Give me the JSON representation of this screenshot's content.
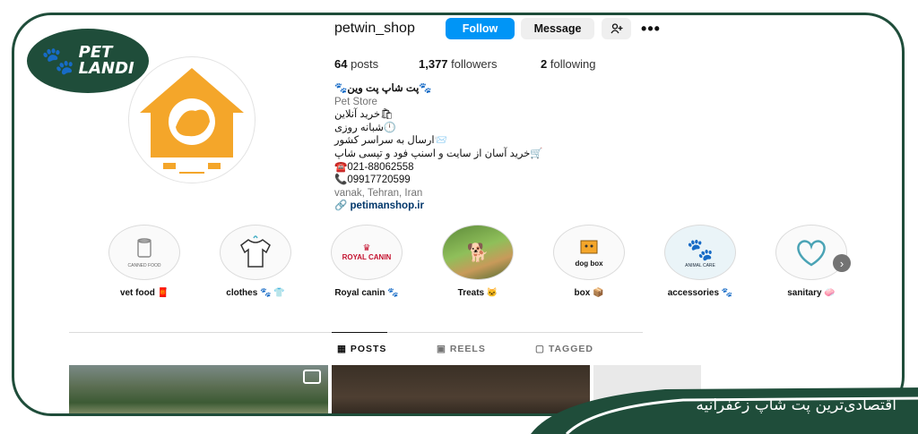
{
  "brand": {
    "logo_line1": "PET",
    "logo_line2": "LANDI"
  },
  "profile": {
    "username": "petwin_shop",
    "follow_label": "Follow",
    "message_label": "Message",
    "posts_count": "64",
    "posts_label": "posts",
    "followers_count": "1,377",
    "followers_label": "followers",
    "following_count": "2",
    "following_label": "following"
  },
  "bio": {
    "name": "🐾پت شاپ پت وین🐾",
    "category": "Pet Store",
    "line1": "🛍خرید آنلاین",
    "line2": "🕛شبانه روزی",
    "line3": "📨ارسال به سراسر کشور",
    "line4": "🛒خرید آسان از سایت و اسنپ فود و تپسی شاپ",
    "phone1": "☎️021-88062558",
    "phone2": "📞09917720599",
    "location": "vanak, Tehran, Iran",
    "link": "petimanshop.ir"
  },
  "highlights": [
    {
      "label": "vet food 🧧",
      "icon": "canned-food"
    },
    {
      "label": "clothes 🐾 👕",
      "icon": "tshirt"
    },
    {
      "label": "Royal canin 🐾",
      "icon": "royal-canin"
    },
    {
      "label": "Treats 🐱",
      "icon": "dog-photo"
    },
    {
      "label": "box 📦",
      "icon": "dog-box"
    },
    {
      "label": "accessories 🐾",
      "icon": "animal-care"
    },
    {
      "label": "sanitary 🧼",
      "icon": "pet-heart"
    }
  ],
  "highlight_text": {
    "canned": "CANNED FOOD",
    "royal": "ROYAL CANIN",
    "dogbox": "dog box",
    "animalcare": "ANIMAL CARE"
  },
  "tabs": {
    "posts": "POSTS",
    "reels": "REELS",
    "tagged": "TAGGED"
  },
  "banner": {
    "text": "اقتصادی‌ترین پت شاپ زعفرانیه"
  },
  "colors": {
    "brand_green": "#1f4d3a",
    "follow_blue": "#0095f6",
    "logo_orange": "#f4a62a"
  }
}
